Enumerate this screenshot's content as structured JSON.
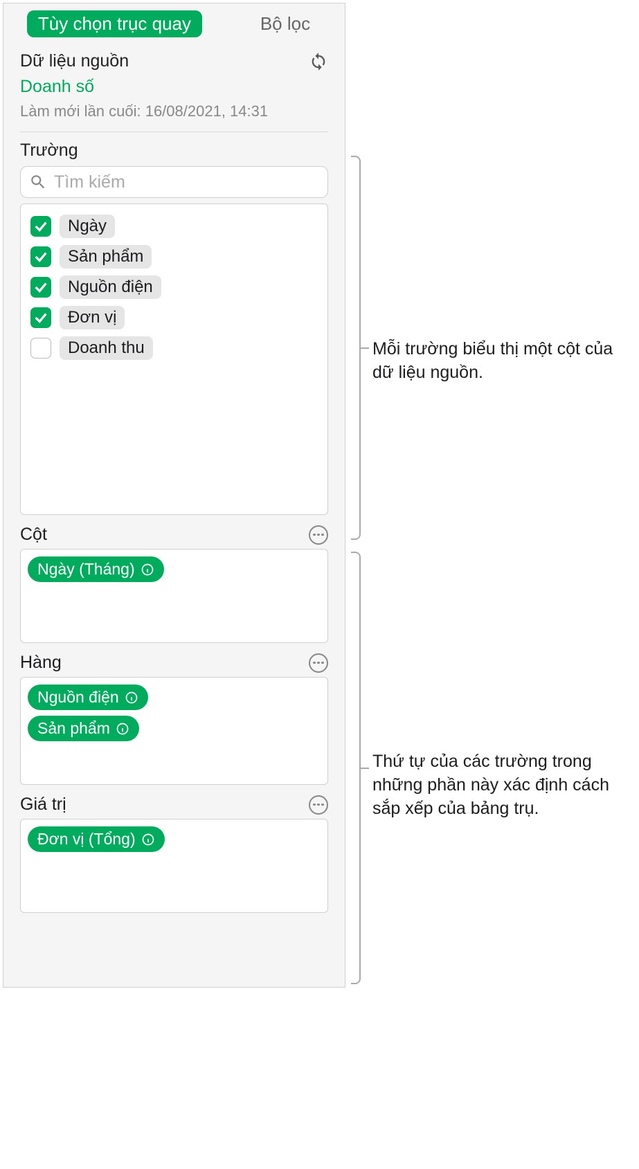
{
  "tabs": {
    "pivot": "Tùy chọn trục quay",
    "filter": "Bộ lọc"
  },
  "source": {
    "label": "Dữ liệu nguồn",
    "name": "Doanh số",
    "refreshed": "Làm mới lần cuối: 16/08/2021, 14:31"
  },
  "fields": {
    "label": "Trường",
    "search_placeholder": "Tìm kiếm",
    "items": [
      {
        "label": "Ngày",
        "checked": true
      },
      {
        "label": "Sản phẩm",
        "checked": true
      },
      {
        "label": "Nguồn điện",
        "checked": true
      },
      {
        "label": "Đơn vị",
        "checked": true
      },
      {
        "label": "Doanh thu",
        "checked": false
      }
    ]
  },
  "columns": {
    "label": "Cột",
    "items": [
      "Ngày (Tháng)"
    ]
  },
  "rows": {
    "label": "Hàng",
    "items": [
      "Nguồn điện",
      "Sản phẩm"
    ]
  },
  "values": {
    "label": "Giá trị",
    "items": [
      "Đơn vị (Tổng)"
    ]
  },
  "annotations": {
    "a1": "Mỗi trường biểu thị một cột của dữ liệu nguồn.",
    "a2": "Thứ tự của các trường trong những phần này xác định cách sắp xếp của bảng trụ."
  }
}
